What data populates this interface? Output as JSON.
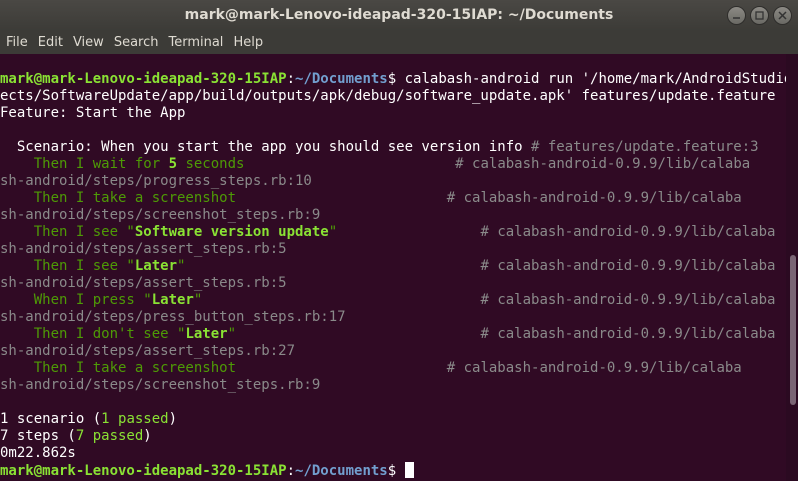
{
  "window": {
    "title": "mark@mark-Lenovo-ideapad-320-15IAP: ~/Documents"
  },
  "menu": [
    "File",
    "Edit",
    "View",
    "Search",
    "Terminal",
    "Help"
  ],
  "prompt": {
    "user_host": "mark@mark-Lenovo-ideapad-320-15IAP",
    "colon": ":",
    "path": "~/Documents",
    "symbol": "$"
  },
  "command_1": " calabash-android run '/home/mark/AndroidStudioProj",
  "command_2": "ects/SoftwareUpdate/app/build/outputs/apk/debug/software_update.apk' features/update.feature",
  "feature": "Feature: Start the App",
  "scenario": {
    "text": "  Scenario: When you start the app you should see version info ",
    "comment": "# features/update.feature:3"
  },
  "steps": [
    {
      "pre": "    Then I wait for ",
      "arg": "5",
      "post": " seconds",
      "pad": "                         ",
      "comment_1": "# calabash-android-0.9.9/lib/calaba",
      "comment_2": "sh-android/steps/progress_steps.rb:10"
    },
    {
      "pre": "    Then I take a screenshot",
      "arg": "",
      "post": "",
      "pad": "                         ",
      "comment_1": "# calabash-android-0.9.9/lib/calaba",
      "comment_2": "sh-android/steps/screenshot_steps.rb:9"
    },
    {
      "pre": "    Then I see \"",
      "arg": "Software version update",
      "post": "\"",
      "pad": "                 ",
      "comment_1": "# calabash-android-0.9.9/lib/calaba",
      "comment_2": "sh-android/steps/assert_steps.rb:5"
    },
    {
      "pre": "    Then I see \"",
      "arg": "Later",
      "post": "\"",
      "pad": "                                   ",
      "comment_1": "# calabash-android-0.9.9/lib/calaba",
      "comment_2": "sh-android/steps/assert_steps.rb:5"
    },
    {
      "pre": "    When I press \"",
      "arg": "Later",
      "post": "\"",
      "pad": "                                 ",
      "comment_1": "# calabash-android-0.9.9/lib/calaba",
      "comment_2": "sh-android/steps/press_button_steps.rb:17"
    },
    {
      "pre": "    Then I don't see \"",
      "arg": "Later",
      "post": "\"",
      "pad": "                             ",
      "comment_1": "# calabash-android-0.9.9/lib/calaba",
      "comment_2": "sh-android/steps/assert_steps.rb:27"
    },
    {
      "pre": "    Then I take a screenshot",
      "arg": "",
      "post": "",
      "pad": "                         ",
      "comment_1": "# calabash-android-0.9.9/lib/calaba",
      "comment_2": "sh-android/steps/screenshot_steps.rb:9"
    }
  ],
  "summary": {
    "scenarios_pre": "1 scenario (",
    "scenarios_passed": "1 passed",
    "scenarios_post": ")",
    "steps_pre": "7 steps (",
    "steps_passed": "7 passed",
    "steps_post": ")",
    "time": "0m22.862s"
  }
}
